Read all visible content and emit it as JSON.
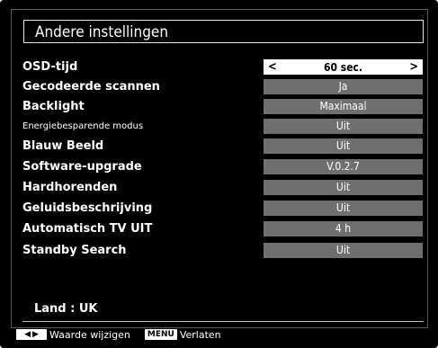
{
  "menu": {
    "title": "Andere instellingen",
    "items": [
      {
        "label": "OSD-tijd",
        "value": "60 sec.",
        "selected": true
      },
      {
        "label": "Gecodeerde scannen",
        "value": "Ja"
      },
      {
        "label": "Backlight",
        "value": "Maximaal"
      },
      {
        "label": "Energiebesparende modus",
        "value": "Uit"
      },
      {
        "label": "Blauw Beeld",
        "value": "Uit"
      },
      {
        "label": "Software-upgrade",
        "value": "V.0.2.7"
      },
      {
        "label": "Hardhorenden",
        "value": "Uit"
      },
      {
        "label": "Geluidsbeschrijving",
        "value": "Uit"
      },
      {
        "label": "Automatisch TV UIT",
        "value": "4 h"
      },
      {
        "label": "Standby Search",
        "value": "Uit"
      }
    ],
    "selected_arrows": {
      "left": "<",
      "right": ">"
    }
  },
  "status": {
    "land": "Land : UK"
  },
  "footer": {
    "arrow_left": "◀",
    "arrow_right": "▶",
    "change_label": "Waarde wijzigen",
    "menu_key": "MENU",
    "exit_label": "Verlaten"
  },
  "colors": {
    "background": "#000000",
    "value_box": "#6f6f6f",
    "selected_box": "#ffffff"
  }
}
